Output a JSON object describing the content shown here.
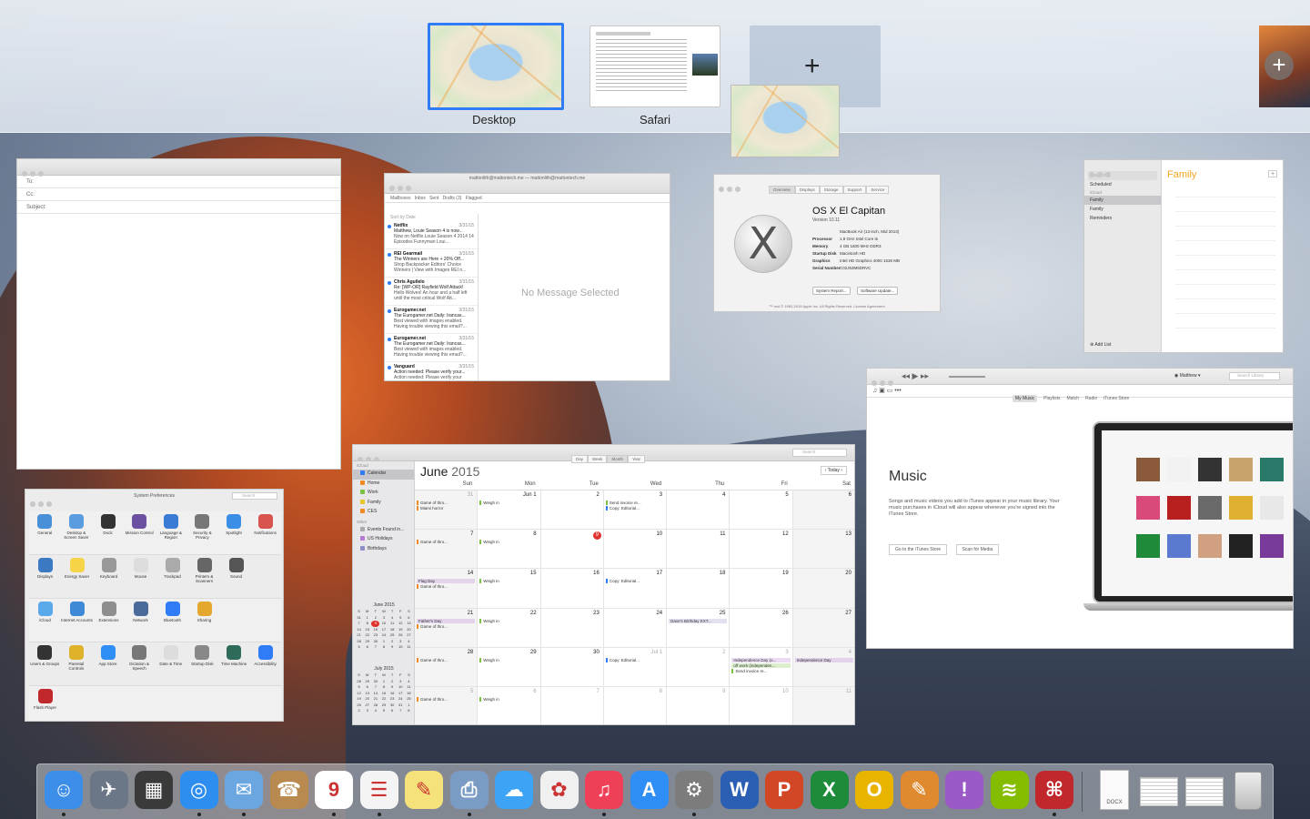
{
  "spaces": {
    "desktop_label": "Desktop",
    "safari_label": "Safari",
    "add_label": "+",
    "fullscreen_add_label": "+"
  },
  "compose": {
    "to_label": "To:",
    "cc_label": "Cc:",
    "subject_label": "Subject:"
  },
  "mail": {
    "window_title": "mattonlith@mattontech.me — mattonlith@mattontech.me",
    "favorites": [
      "Mailboxes",
      "Inbox",
      "Sent",
      "Drafts (3)",
      "Flagged"
    ],
    "sort_label": "Sort by Date",
    "no_message": "No Message Selected",
    "messages": [
      {
        "from": "Netflix",
        "date": "3/31/15",
        "subject": "Matthew, Louie Season 4 is now...",
        "preview": "Now on Netflix Louie Season 4 2014 14 Episodes Funnyman Loui..."
      },
      {
        "from": "REI Gearmail",
        "date": "3/31/15",
        "subject": "The Winners are Here + 20% Off...",
        "preview": "Shop Backpacker Editors' Choice Winners | View with Images REI n..."
      },
      {
        "from": "Chris Aguilelo",
        "date": "3/31/15",
        "subject": "Re: [WP-OR] Rayfield Wolf Attack!",
        "preview": "Hello Wolves! An hour and a half left until the most critical Wolf Att..."
      },
      {
        "from": "Eurogamer.net",
        "date": "3/31/15",
        "subject": "The Eurogamer.net Daily: Irancas...",
        "preview": "Best viewed with images enabled. Having trouble viewing this email?..."
      },
      {
        "from": "Eurogamer.net",
        "date": "3/31/15",
        "subject": "The Eurogamer.net Daily: Irancas...",
        "preview": "Best viewed with images enabled. Having trouble viewing this email?..."
      },
      {
        "from": "Vanguard",
        "date": "3/31/15",
        "subject": "Action needed: Please verify your...",
        "preview": "Action needed: Please verify your mailing address Dear Matthew Sm..."
      }
    ]
  },
  "about": {
    "tabs": [
      "Overview",
      "Displays",
      "Storage",
      "Support",
      "Service"
    ],
    "title": "OS X El Capitan",
    "version": "Version 10.11",
    "specs": [
      {
        "k": "",
        "v": "MacBook Air (13-inch, Mid 2013)"
      },
      {
        "k": "Processor",
        "v": "1.8 GHz Intel Core i5"
      },
      {
        "k": "Memory",
        "v": "4 GB 1600 MHz DDR3"
      },
      {
        "k": "Startup Disk",
        "v": "Macintosh HD"
      },
      {
        "k": "Graphics",
        "v": "Intel HD Graphics 4000 1536 MB"
      },
      {
        "k": "Serial Number",
        "v": "C02J63M6DRVC"
      }
    ],
    "buttons": [
      "System Report...",
      "Software Update..."
    ],
    "footer": "™ and © 1983-2015 Apple Inc. All Rights Reserved. License Agreement"
  },
  "reminders": {
    "search_placeholder": "Search",
    "scheduled": "Scheduled",
    "icloud_head": "iCloud",
    "lists": [
      "Family",
      "Family",
      "Reminders"
    ],
    "title": "Family",
    "add_list": "Add List"
  },
  "prefs": {
    "title": "System Preferences",
    "search_placeholder": "Search",
    "rows": [
      [
        {
          "label": "General",
          "color": "#4a90d9"
        },
        {
          "label": "Desktop & Screen Saver",
          "color": "#5b9be0"
        },
        {
          "label": "Dock",
          "color": "#333333"
        },
        {
          "label": "Mission Control",
          "color": "#6b4fa0"
        },
        {
          "label": "Language & Region",
          "color": "#3a7bd5"
        },
        {
          "label": "Security & Privacy",
          "color": "#777777"
        },
        {
          "label": "Spotlight",
          "color": "#3a8ee6"
        },
        {
          "label": "Notifications",
          "color": "#d9534f"
        }
      ],
      [
        {
          "label": "Displays",
          "color": "#3b79c2"
        },
        {
          "label": "Energy Saver",
          "color": "#f5d547"
        },
        {
          "label": "Keyboard",
          "color": "#999999"
        },
        {
          "label": "Mouse",
          "color": "#dddddd"
        },
        {
          "label": "Trackpad",
          "color": "#aaaaaa"
        },
        {
          "label": "Printers & Scanners",
          "color": "#666666"
        },
        {
          "label": "Sound",
          "color": "#555555"
        }
      ],
      [
        {
          "label": "iCloud",
          "color": "#5aa9ea"
        },
        {
          "label": "Internet Accounts",
          "color": "#3e8ad6"
        },
        {
          "label": "Extensions",
          "color": "#8e8e8e"
        },
        {
          "label": "Network",
          "color": "#4a6b9a"
        },
        {
          "label": "Bluetooth",
          "color": "#2f7cf6"
        },
        {
          "label": "Sharing",
          "color": "#e5a82e"
        }
      ],
      [
        {
          "label": "Users & Groups",
          "color": "#333333"
        },
        {
          "label": "Parental Controls",
          "color": "#e0b12a"
        },
        {
          "label": "App Store",
          "color": "#2f8ef6"
        },
        {
          "label": "Dictation & Speech",
          "color": "#777777"
        },
        {
          "label": "Date & Time",
          "color": "#dddddd"
        },
        {
          "label": "Startup Disk",
          "color": "#888888"
        },
        {
          "label": "Time Machine",
          "color": "#2e6b5a"
        },
        {
          "label": "Accessibility",
          "color": "#2f7cf6"
        }
      ],
      [
        {
          "label": "Flash Player",
          "color": "#c0282b"
        }
      ]
    ]
  },
  "calendar": {
    "view_tabs": [
      "Day",
      "Week",
      "Month",
      "Year"
    ],
    "search_placeholder": "Search",
    "month": "June",
    "year": "2015",
    "today_label": "Today",
    "icloud_head": "iCloud",
    "other_head": "Other",
    "calendars": [
      {
        "name": "Calendar",
        "color": "#2f7cf6",
        "sel": true
      },
      {
        "name": "Home",
        "color": "#f08a24"
      },
      {
        "name": "Work",
        "color": "#7cc242"
      },
      {
        "name": "Family",
        "color": "#e8c62a"
      },
      {
        "name": "CES",
        "color": "#f08a24"
      }
    ],
    "others": [
      {
        "name": "Events Found in...",
        "color": "#aaaaaa"
      },
      {
        "name": "US Holidays",
        "color": "#b57ad6"
      },
      {
        "name": "Birthdays",
        "color": "#8e8ec8"
      }
    ],
    "mini1_title": "June 2015",
    "mini2_title": "July 2015",
    "mini_dow": [
      "S",
      "M",
      "T",
      "W",
      "T",
      "F",
      "S"
    ],
    "mini1_days": [
      "31",
      "1",
      "2",
      "3",
      "4",
      "5",
      "6",
      "7",
      "8",
      "9",
      "10",
      "11",
      "12",
      "13",
      "14",
      "15",
      "16",
      "17",
      "18",
      "19",
      "20",
      "21",
      "22",
      "23",
      "24",
      "25",
      "26",
      "27",
      "28",
      "29",
      "30",
      "1",
      "2",
      "3",
      "4",
      "5",
      "6",
      "7",
      "8",
      "9",
      "10",
      "11"
    ],
    "mini2_days": [
      "28",
      "29",
      "30",
      "1",
      "2",
      "3",
      "4",
      "5",
      "6",
      "7",
      "8",
      "9",
      "10",
      "11",
      "12",
      "13",
      "14",
      "15",
      "16",
      "17",
      "18",
      "19",
      "20",
      "21",
      "22",
      "23",
      "24",
      "25",
      "26",
      "27",
      "28",
      "29",
      "30",
      "31",
      "1",
      "2",
      "3",
      "4",
      "5",
      "6",
      "7",
      "8"
    ],
    "dow": [
      "Sun",
      "Mon",
      "Tue",
      "Wed",
      "Thu",
      "Fri",
      "Sat"
    ],
    "weeks": [
      [
        {
          "n": "31",
          "dim": true,
          "ev": [
            [
              "Game of thro...",
              "#f08a24"
            ],
            [
              "Miami horror",
              "#f08a24"
            ]
          ]
        },
        {
          "n": "Jun 1",
          "ev": [
            [
              "Weigh in",
              "#7cc242"
            ]
          ]
        },
        {
          "n": "2"
        },
        {
          "n": "3",
          "ev": [
            [
              "Send invoice re...",
              "#7cc242"
            ],
            [
              "Copy: Editorial...",
              "#2f7cf6"
            ]
          ]
        },
        {
          "n": "4"
        },
        {
          "n": "5"
        },
        {
          "n": "6"
        }
      ],
      [
        {
          "n": "7",
          "ev": [
            [
              "Game of thro...",
              "#f08a24"
            ]
          ]
        },
        {
          "n": "8",
          "ev": [
            [
              "Weigh in",
              "#7cc242"
            ]
          ]
        },
        {
          "n": "9",
          "today": true
        },
        {
          "n": "10"
        },
        {
          "n": "11"
        },
        {
          "n": "12"
        },
        {
          "n": "13"
        }
      ],
      [
        {
          "n": "14",
          "ev": [
            [
              "Flag Day",
              "#b57ad6",
              "block"
            ],
            [
              "Game of thro...",
              "#f08a24"
            ]
          ]
        },
        {
          "n": "15",
          "ev": [
            [
              "Weigh in",
              "#7cc242"
            ]
          ]
        },
        {
          "n": "16"
        },
        {
          "n": "17",
          "ev": [
            [
              "Copy: Editorial...",
              "#2f7cf6"
            ]
          ]
        },
        {
          "n": "18"
        },
        {
          "n": "19"
        },
        {
          "n": "20"
        }
      ],
      [
        {
          "n": "21",
          "ev": [
            [
              "Father's Day",
              "#b57ad6",
              "block"
            ],
            [
              "Game of thro...",
              "#f08a24"
            ]
          ]
        },
        {
          "n": "22",
          "ev": [
            [
              "Weigh in",
              "#7cc242"
            ]
          ]
        },
        {
          "n": "23"
        },
        {
          "n": "24"
        },
        {
          "n": "25",
          "ev": [
            [
              "Dave's Birthday EXT...",
              "#8e8ec8",
              "block"
            ]
          ]
        },
        {
          "n": "26"
        },
        {
          "n": "27"
        }
      ],
      [
        {
          "n": "28",
          "ev": [
            [
              "Game of thro...",
              "#f08a24"
            ]
          ]
        },
        {
          "n": "29",
          "ev": [
            [
              "Weigh in",
              "#7cc242"
            ]
          ]
        },
        {
          "n": "30"
        },
        {
          "n": "Jul 1",
          "dim": true,
          "ev": [
            [
              "Copy: Editorial...",
              "#2f7cf6"
            ]
          ]
        },
        {
          "n": "2",
          "dim": true
        },
        {
          "n": "3",
          "dim": true,
          "ev": [
            [
              "Independence Day (o...",
              "#b57ad6",
              "block"
            ],
            [
              "off work (independen...",
              "#7cc242",
              "block"
            ],
            [
              "Send invoice re...",
              "#7cc242"
            ]
          ]
        },
        {
          "n": "4",
          "dim": true,
          "ev": [
            [
              "Independence Day",
              "#b57ad6",
              "block"
            ]
          ]
        }
      ],
      [
        {
          "n": "5",
          "dim": true,
          "ev": [
            [
              "Game of thro...",
              "#f08a24"
            ]
          ]
        },
        {
          "n": "6",
          "dim": true,
          "ev": [
            [
              "Weigh in",
              "#7cc242"
            ]
          ]
        },
        {
          "n": "7",
          "dim": true
        },
        {
          "n": "8",
          "dim": true
        },
        {
          "n": "9",
          "dim": true
        },
        {
          "n": "10",
          "dim": true
        },
        {
          "n": "11",
          "dim": true
        }
      ]
    ]
  },
  "itunes": {
    "user": "Matthew",
    "search_placeholder": "Search Library",
    "tabs": [
      "My Music",
      "Playlists",
      "Match",
      "Radio",
      "iTunes Store"
    ],
    "title": "Music",
    "description": "Songs and music videos you add to iTunes appear in your music library. Your music purchases in iCloud will also appear whenever you're signed into the iTunes Store.",
    "btn_store": "Go to the iTunes Store",
    "btn_scan": "Scan for Media"
  },
  "dock": {
    "apps": [
      {
        "name": "finder-icon",
        "glyph": "☺",
        "color": "#3d8ee8",
        "running": true
      },
      {
        "name": "launchpad-icon",
        "glyph": "✈",
        "color": "#6b7686",
        "running": false
      },
      {
        "name": "mission-control-icon",
        "glyph": "▦",
        "color": "#3a3a3a",
        "running": false
      },
      {
        "name": "safari-icon",
        "glyph": "◎",
        "color": "#2e8ef0",
        "running": true
      },
      {
        "name": "mail-icon",
        "glyph": "✉",
        "color": "#6aa7e0",
        "running": true
      },
      {
        "name": "contacts-icon",
        "glyph": "☎",
        "color": "#b88a50",
        "running": false
      },
      {
        "name": "calendar-icon",
        "glyph": "9",
        "color": "#ffffff",
        "running": true
      },
      {
        "name": "reminders-icon",
        "glyph": "☰",
        "color": "#f4f4f4",
        "running": true
      },
      {
        "name": "notes-icon",
        "glyph": "✎",
        "color": "#f6e27a",
        "running": false
      },
      {
        "name": "preview-icon",
        "glyph": "⎙",
        "color": "#7a9cc4",
        "running": true
      },
      {
        "name": "messages-icon",
        "glyph": "☁",
        "color": "#3da3f5",
        "running": false
      },
      {
        "name": "photos-icon",
        "glyph": "✿",
        "color": "#f0f0f0",
        "running": false
      },
      {
        "name": "itunes-icon",
        "glyph": "♫",
        "color": "#f04058",
        "running": true
      },
      {
        "name": "app-store-icon",
        "glyph": "A",
        "color": "#2f8ef6",
        "running": false
      },
      {
        "name": "system-preferences-icon",
        "glyph": "⚙",
        "color": "#7c7c7c",
        "running": true
      },
      {
        "name": "word-icon",
        "glyph": "W",
        "color": "#2b5fb4",
        "running": false
      },
      {
        "name": "powerpoint-icon",
        "glyph": "P",
        "color": "#d24726",
        "running": false
      },
      {
        "name": "excel-icon",
        "glyph": "X",
        "color": "#1e8b3a",
        "running": false
      },
      {
        "name": "outlook-icon",
        "glyph": "O",
        "color": "#e8b400",
        "running": false
      },
      {
        "name": "ibooks-icon",
        "glyph": "✎",
        "color": "#e08a30",
        "running": false
      },
      {
        "name": "feedback-icon",
        "glyph": "!",
        "color": "#9b59c7",
        "running": false
      },
      {
        "name": "spotify-icon",
        "glyph": "≋",
        "color": "#84bd00",
        "running": false
      },
      {
        "name": "acrobat-icon",
        "glyph": "⌘",
        "color": "#c0282b",
        "running": true
      }
    ],
    "docs_label": "DOCX",
    "trash": "trash-icon"
  }
}
